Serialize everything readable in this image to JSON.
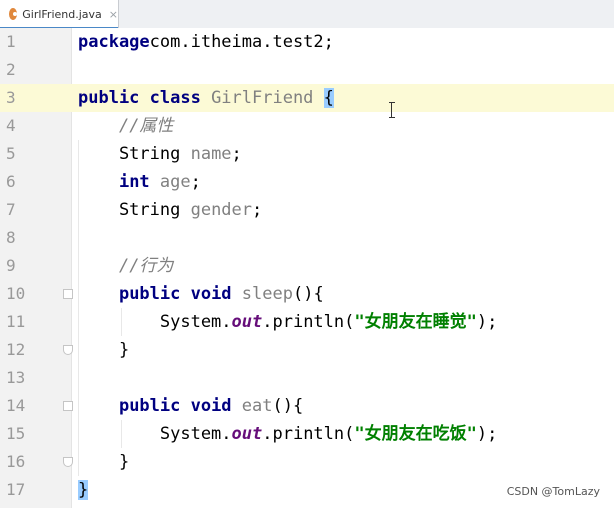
{
  "tab": {
    "filename": "GirlFriend.java",
    "close_glyph": "×",
    "icon": "java-class-icon"
  },
  "lines": [
    {
      "n": "1",
      "tokens": [
        [
          "kw",
          "package"
        ],
        [
          "",
          "com.itheima.test2;"
        ]
      ]
    },
    {
      "n": "2",
      "tokens": []
    },
    {
      "n": "3",
      "tokens": [
        [
          "kw",
          "public class "
        ],
        [
          "uncls",
          "GirlFriend "
        ],
        [
          "brace-hl",
          "{"
        ]
      ]
    },
    {
      "n": "4",
      "tokens": [
        [
          "",
          "    "
        ],
        [
          "cmt",
          "//属性"
        ]
      ]
    },
    {
      "n": "5",
      "tokens": [
        [
          "",
          "    String "
        ],
        [
          "uncls",
          "name"
        ],
        [
          "",
          ";"
        ]
      ]
    },
    {
      "n": "6",
      "tokens": [
        [
          "",
          "    "
        ],
        [
          "kw",
          "int "
        ],
        [
          "uncls",
          "age"
        ],
        [
          "",
          ";"
        ]
      ]
    },
    {
      "n": "7",
      "tokens": [
        [
          "",
          "    String "
        ],
        [
          "uncls",
          "gender"
        ],
        [
          "",
          ";"
        ]
      ]
    },
    {
      "n": "8",
      "tokens": []
    },
    {
      "n": "9",
      "tokens": [
        [
          "",
          "    "
        ],
        [
          "cmt",
          "//行为"
        ]
      ]
    },
    {
      "n": "10",
      "tokens": [
        [
          "",
          "    "
        ],
        [
          "kw",
          "public void "
        ],
        [
          "uncls",
          "sleep"
        ],
        [
          "",
          "(){"
        ]
      ]
    },
    {
      "n": "11",
      "tokens": [
        [
          "",
          "        System."
        ],
        [
          "stat",
          "out"
        ],
        [
          "",
          ".println("
        ],
        [
          "str",
          "\"女朋友在睡觉\""
        ],
        [
          "",
          ");"
        ]
      ]
    },
    {
      "n": "12",
      "tokens": [
        [
          "",
          "    }"
        ]
      ]
    },
    {
      "n": "13",
      "tokens": []
    },
    {
      "n": "14",
      "tokens": [
        [
          "",
          "    "
        ],
        [
          "kw",
          "public void "
        ],
        [
          "uncls",
          "eat"
        ],
        [
          "",
          "(){"
        ]
      ]
    },
    {
      "n": "15",
      "tokens": [
        [
          "",
          "        System."
        ],
        [
          "stat",
          "out"
        ],
        [
          "",
          ".println("
        ],
        [
          "str",
          "\"女朋友在吃饭\""
        ],
        [
          "",
          ");"
        ]
      ]
    },
    {
      "n": "16",
      "tokens": [
        [
          "",
          "    }"
        ]
      ]
    },
    {
      "n": "17",
      "tokens": [
        [
          "brace-hl",
          "}"
        ]
      ]
    }
  ],
  "current_line": 3,
  "watermark": "CSDN @TomLazy"
}
